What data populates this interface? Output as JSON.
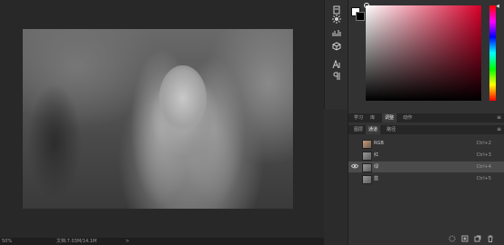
{
  "status_bar": {
    "zoom": "50%",
    "doc_size": "文档:7.03M/14.1M",
    "arrow": ">"
  },
  "tools": {
    "icons": [
      "history-icon",
      "brush-settings-icon",
      "histogram-icon",
      "3d-cube-icon",
      "character-icon",
      "paragraph-icon"
    ]
  },
  "color_panel": {
    "foreground": "#ffffff",
    "background": "#000000",
    "hue_marker": "◀"
  },
  "panel_tabs": {
    "tabs": [
      "学习",
      "库",
      "调整",
      "动作"
    ],
    "active": "调整",
    "menu": "≡"
  },
  "layer_tabs": {
    "tabs": [
      "图层",
      "通道",
      "路径"
    ],
    "active": "通道",
    "menu": "≡"
  },
  "channels": [
    {
      "name": "RGB",
      "shortcut": "Ctrl+2",
      "visible": false,
      "selected": false,
      "thumb": "rgb"
    },
    {
      "name": "红",
      "shortcut": "Ctrl+3",
      "visible": false,
      "selected": false,
      "thumb": "gray"
    },
    {
      "name": "绿",
      "shortcut": "Ctrl+4",
      "visible": true,
      "selected": true,
      "thumb": "gray"
    },
    {
      "name": "蓝",
      "shortcut": "Ctrl+5",
      "visible": false,
      "selected": false,
      "thumb": "gray"
    }
  ],
  "eye_glyph": "👁",
  "bottom_icons": [
    {
      "name": "load-selection-icon",
      "glyph": "◌"
    },
    {
      "name": "save-selection-icon",
      "glyph": "◘"
    },
    {
      "name": "new-channel-icon",
      "glyph": "⧉"
    },
    {
      "name": "delete-icon",
      "glyph": "🗑"
    }
  ]
}
